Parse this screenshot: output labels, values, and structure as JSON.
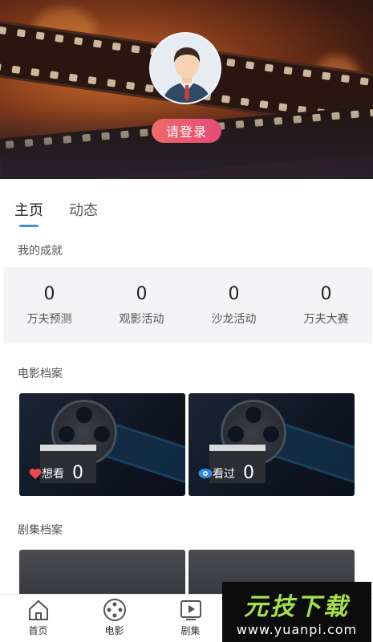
{
  "header": {
    "login_label": "请登录"
  },
  "tabs": [
    {
      "label": "主页",
      "active": true
    },
    {
      "label": "动态",
      "active": false
    }
  ],
  "achievements": {
    "title": "我的成就",
    "items": [
      {
        "value": "0",
        "label": "万夫预测"
      },
      {
        "value": "0",
        "label": "观影活动"
      },
      {
        "value": "0",
        "label": "沙龙活动"
      },
      {
        "value": "0",
        "label": "万夫大赛"
      }
    ]
  },
  "movie_archive": {
    "title": "电影档案",
    "cards": [
      {
        "label": "想看",
        "count": "0",
        "icon": "heart-icon",
        "icon_color": "#f0464f"
      },
      {
        "label": "看过",
        "count": "0",
        "icon": "eye-icon",
        "icon_color": "#2e8be6"
      }
    ]
  },
  "series_archive": {
    "title": "剧集档案"
  },
  "tabbar": [
    {
      "label": "首页",
      "icon": "home-icon"
    },
    {
      "label": "电影",
      "icon": "film-reel-icon"
    },
    {
      "label": "剧集",
      "icon": "play-icon"
    }
  ],
  "watermark": {
    "brand": "元技下载",
    "url": "www.yuanpi.com"
  },
  "colors": {
    "accent": "#3d8fe8",
    "login_gradient_start": "#f06a6a",
    "login_gradient_end": "#e44b7a",
    "watermark_green": "#a6e04a"
  }
}
